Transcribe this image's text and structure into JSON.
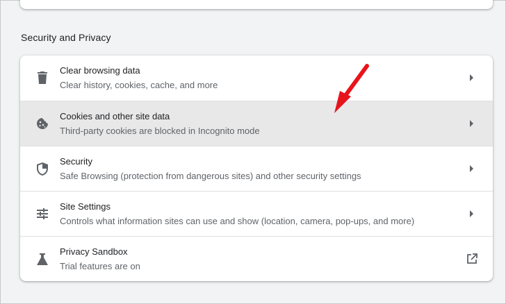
{
  "section": {
    "title": "Security and Privacy"
  },
  "rows": [
    {
      "title": "Clear browsing data",
      "subtitle": "Clear history, cookies, cache, and more",
      "icon": "trash-icon",
      "trail": "chevron-right-icon"
    },
    {
      "title": "Cookies and other site data",
      "subtitle": "Third-party cookies are blocked in Incognito mode",
      "icon": "cookie-icon",
      "trail": "chevron-right-icon"
    },
    {
      "title": "Security",
      "subtitle": "Safe Browsing (protection from dangerous sites) and other security settings",
      "icon": "shield-icon",
      "trail": "chevron-right-icon"
    },
    {
      "title": "Site Settings",
      "subtitle": "Controls what information sites can use and show (location, camera, pop-ups, and more)",
      "icon": "sliders-icon",
      "trail": "chevron-right-icon"
    },
    {
      "title": "Privacy Sandbox",
      "subtitle": "Trial features are on",
      "icon": "flask-icon",
      "trail": "external-link-icon"
    }
  ],
  "colors": {
    "icon": "#5f6368",
    "hover_row": "#e8e8e8",
    "annotation_arrow": "#e8141c"
  }
}
